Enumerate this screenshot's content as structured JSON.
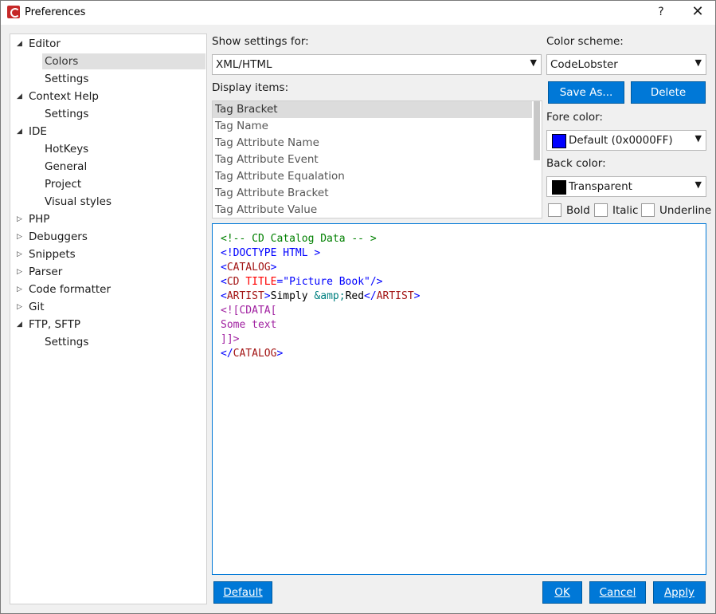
{
  "window": {
    "title": "Preferences",
    "help_label": "?",
    "close_label": "✕"
  },
  "tree": [
    {
      "label": "Editor",
      "level": 0,
      "expanded": true,
      "has_children": true
    },
    {
      "label": "Colors",
      "level": 1,
      "selected": true
    },
    {
      "label": "Settings",
      "level": 1
    },
    {
      "label": "Context Help",
      "level": 0,
      "expanded": true,
      "has_children": true
    },
    {
      "label": "Settings",
      "level": 1
    },
    {
      "label": "IDE",
      "level": 0,
      "expanded": true,
      "has_children": true
    },
    {
      "label": "HotKeys",
      "level": 1
    },
    {
      "label": "General",
      "level": 1
    },
    {
      "label": "Project",
      "level": 1
    },
    {
      "label": "Visual styles",
      "level": 1
    },
    {
      "label": "PHP",
      "level": 0,
      "expanded": false,
      "has_children": true
    },
    {
      "label": "Debuggers",
      "level": 0,
      "expanded": false,
      "has_children": true
    },
    {
      "label": "Snippets",
      "level": 0,
      "expanded": false,
      "has_children": true
    },
    {
      "label": "Parser",
      "level": 0,
      "expanded": false,
      "has_children": true
    },
    {
      "label": "Code formatter",
      "level": 0,
      "expanded": false,
      "has_children": true
    },
    {
      "label": "Git",
      "level": 0,
      "expanded": false,
      "has_children": true
    },
    {
      "label": "FTP, SFTP",
      "level": 0,
      "expanded": true,
      "has_children": true
    },
    {
      "label": "Settings",
      "level": 1
    }
  ],
  "settings": {
    "show_for_label": "Show settings for:",
    "show_for_value": "XML/HTML",
    "display_items_label": "Display items:",
    "display_items": [
      "Tag Bracket",
      "Tag Name",
      "Tag Attribute Name",
      "Tag Attribute Event",
      "Tag Attribute Equalation",
      "Tag Attribute Bracket",
      "Tag Attribute Value"
    ],
    "selected_item_index": 0
  },
  "scheme": {
    "label": "Color scheme:",
    "value": "CodeLobster",
    "save_as_label": "Save As...",
    "delete_label": "Delete",
    "fore_label": "Fore color:",
    "fore_value": "Default (0x0000FF)",
    "fore_swatch": "#0000ff",
    "back_label": "Back color:",
    "back_value": "Transparent",
    "back_swatch": "#000000",
    "bold_label": "Bold",
    "italic_label": "Italic",
    "underline_label": "Underline",
    "bold_checked": false,
    "italic_checked": false,
    "underline_checked": false
  },
  "preview": [
    [
      {
        "t": "<!-- CD Catalog Data -- >",
        "c": "comment"
      }
    ],
    [
      {
        "t": "<!DOCTYPE HTML >",
        "c": "bracket"
      }
    ],
    [
      {
        "t": "<",
        "c": "bracket"
      },
      {
        "t": "CATALOG",
        "c": "tag"
      },
      {
        "t": ">",
        "c": "bracket"
      }
    ],
    [
      {
        "t": "<",
        "c": "bracket"
      },
      {
        "t": "CD",
        "c": "tag"
      },
      {
        "t": " ",
        "c": "text"
      },
      {
        "t": "TITLE",
        "c": "attr"
      },
      {
        "t": "=",
        "c": "bracket"
      },
      {
        "t": "\"Picture Book\"",
        "c": "value"
      },
      {
        "t": "/>",
        "c": "bracket"
      }
    ],
    [
      {
        "t": "<",
        "c": "bracket"
      },
      {
        "t": "ARTIST",
        "c": "tag"
      },
      {
        "t": ">",
        "c": "bracket"
      },
      {
        "t": "Simply ",
        "c": "text"
      },
      {
        "t": "&amp;",
        "c": "entity"
      },
      {
        "t": "Red",
        "c": "text"
      },
      {
        "t": "</",
        "c": "bracket"
      },
      {
        "t": "ARTIST",
        "c": "tag"
      },
      {
        "t": ">",
        "c": "bracket"
      }
    ],
    [
      {
        "t": "<![CDATA[",
        "c": "cdata"
      }
    ],
    [
      {
        "t": "Some text",
        "c": "cdata"
      }
    ],
    [
      {
        "t": "]]>",
        "c": "cdata"
      }
    ],
    [
      {
        "t": "</",
        "c": "bracket"
      },
      {
        "t": "CATALOG",
        "c": "tag"
      },
      {
        "t": ">",
        "c": "bracket"
      }
    ]
  ],
  "buttons": {
    "default_label": "Default",
    "ok_label": "OK",
    "cancel_label": "Cancel",
    "apply_label": "Apply"
  },
  "colors": {
    "accent": "#0078d7",
    "comment": "#008000",
    "bracket": "#0000ff",
    "tag": "#a31515",
    "attr": "#ff0000",
    "value": "#0000ff",
    "entity": "#008080",
    "cdata": "#a020a0"
  }
}
